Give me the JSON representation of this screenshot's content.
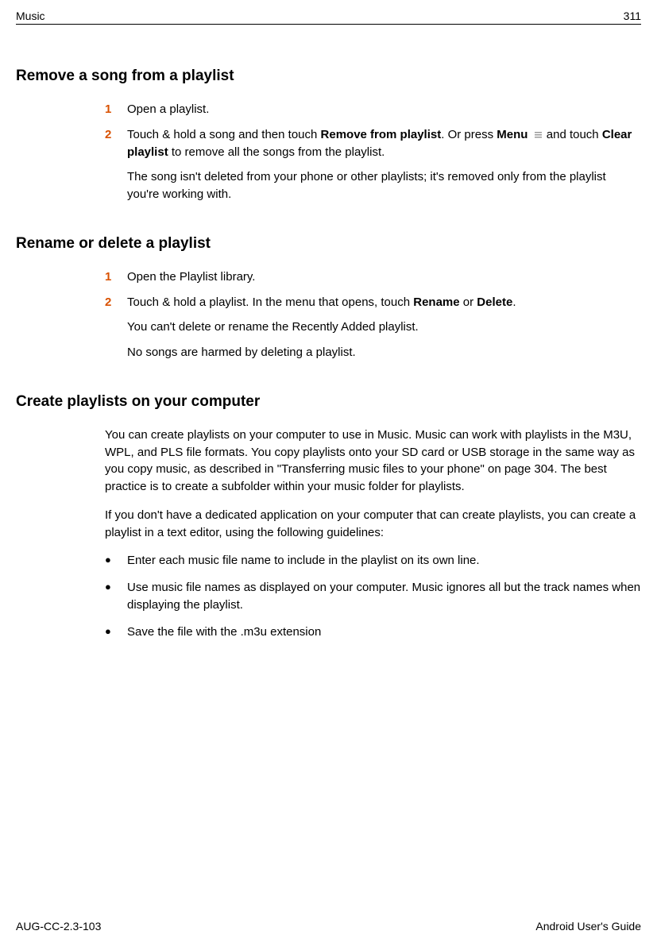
{
  "header": {
    "chapter": "Music",
    "page": "311"
  },
  "sections": {
    "remove": {
      "title": "Remove a song from a playlist",
      "step1": {
        "num": "1",
        "text": "Open a playlist."
      },
      "step2": {
        "num": "2",
        "text_a": "Touch & hold a song and then touch ",
        "bold_a": "Remove from playlist",
        "text_b": ". Or press ",
        "bold_b": "Menu",
        "text_c": " and touch ",
        "bold_c": "Clear playlist",
        "text_d": " to remove all the songs from the playlist."
      },
      "note": "The song isn't deleted from your phone or other playlists; it's removed only from the playlist you're working with."
    },
    "rename": {
      "title": "Rename or delete a playlist",
      "step1": {
        "num": "1",
        "text": "Open the Playlist library."
      },
      "step2": {
        "num": "2",
        "text_a": "Touch & hold a playlist. In the menu that opens, touch ",
        "bold_a": "Rename",
        "text_b": " or ",
        "bold_b": "Delete",
        "text_c": "."
      },
      "note1": "You can't delete or rename the Recently Added playlist.",
      "note2": "No songs are harmed by deleting a playlist."
    },
    "create": {
      "title": "Create playlists on your computer",
      "para1": "You can create playlists on your computer to use in Music. Music can work with playlists in the M3U, WPL, and PLS file formats. You copy playlists onto your SD card or USB storage in the same way as you copy music, as described in \"Transferring music files to your phone\" on page 304. The best practice is to create a subfolder within your music folder for playlists.",
      "para2": "If you don't have a dedicated application on your computer that can create playlists, you can create a playlist in a text editor, using the following guidelines:",
      "bullet1": "Enter each music file name to include in the playlist on its own line.",
      "bullet2": "Use music file names as displayed on your computer. Music ignores all but the track names when displaying the playlist.",
      "bullet3": "Save the file with the .m3u extension"
    }
  },
  "footer": {
    "docid": "AUG-CC-2.3-103",
    "guide": "Android User's Guide"
  }
}
